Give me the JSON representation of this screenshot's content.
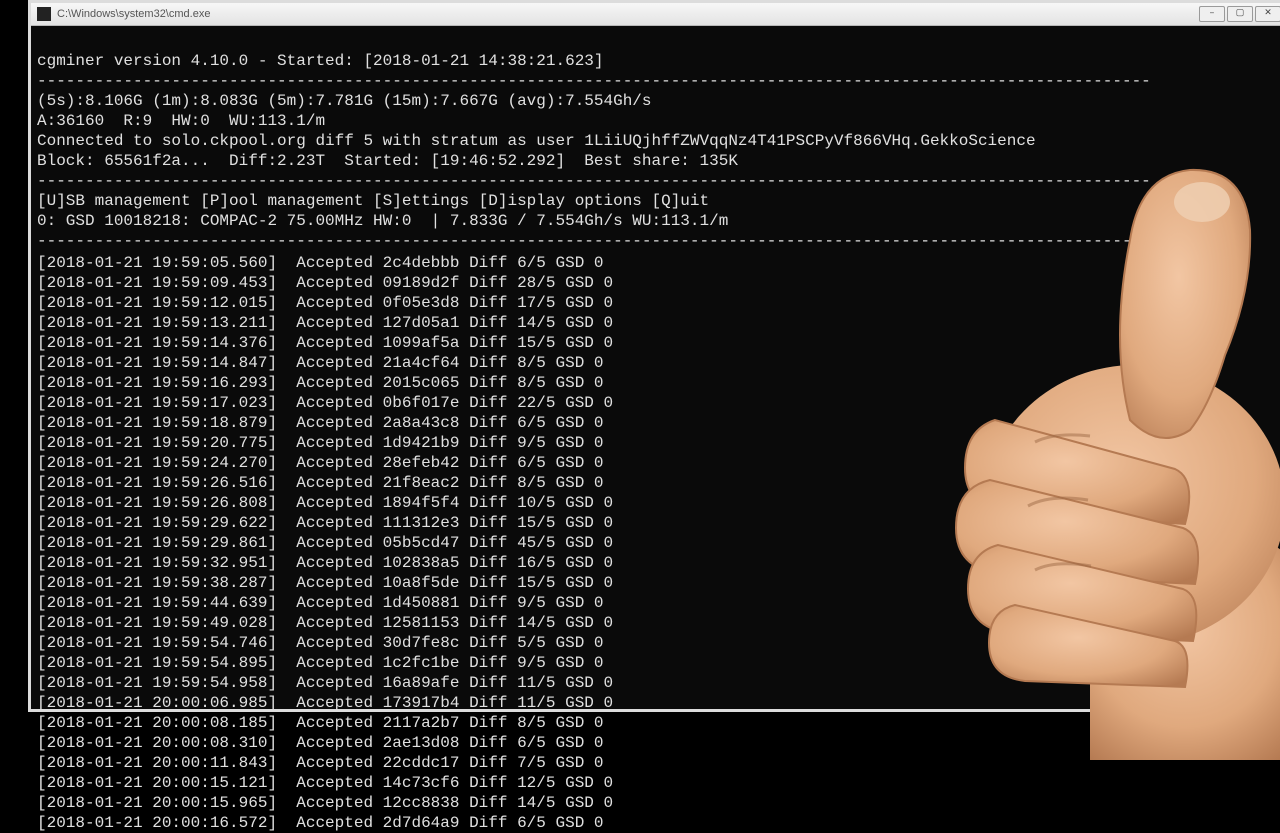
{
  "window": {
    "title": "C:\\Windows\\system32\\cmd.exe"
  },
  "header": {
    "line1": "cgminer version 4.10.0 - Started: [2018-01-21 14:38:21.623]"
  },
  "stats": {
    "hash": "(5s):8.106G (1m):8.083G (5m):7.781G (15m):7.667G (avg):7.554Gh/s",
    "accepts": "A:36160  R:9  HW:0  WU:113.1/m",
    "connected": "Connected to solo.ckpool.org diff 5 with stratum as user 1LiiUQjhffZWVqqNz4T41PSCPyVf866VHq.GekkoScience",
    "block": "Block: 65561f2a...  Diff:2.23T  Started: [19:46:52.292]  Best share: 135K"
  },
  "menu": {
    "options": "[U]SB management [P]ool management [S]ettings [D]isplay options [Q]uit",
    "device": "0: GSD 10018218: COMPAC-2 75.00MHz HW:0  | 7.833G / 7.554Gh/s WU:113.1/m"
  },
  "log": [
    "[2018-01-21 19:59:05.560]  Accepted 2c4debbb Diff 6/5 GSD 0",
    "[2018-01-21 19:59:09.453]  Accepted 09189d2f Diff 28/5 GSD 0",
    "[2018-01-21 19:59:12.015]  Accepted 0f05e3d8 Diff 17/5 GSD 0",
    "[2018-01-21 19:59:13.211]  Accepted 127d05a1 Diff 14/5 GSD 0",
    "[2018-01-21 19:59:14.376]  Accepted 1099af5a Diff 15/5 GSD 0",
    "[2018-01-21 19:59:14.847]  Accepted 21a4cf64 Diff 8/5 GSD 0",
    "[2018-01-21 19:59:16.293]  Accepted 2015c065 Diff 8/5 GSD 0",
    "[2018-01-21 19:59:17.023]  Accepted 0b6f017e Diff 22/5 GSD 0",
    "[2018-01-21 19:59:18.879]  Accepted 2a8a43c8 Diff 6/5 GSD 0",
    "[2018-01-21 19:59:20.775]  Accepted 1d9421b9 Diff 9/5 GSD 0",
    "[2018-01-21 19:59:24.270]  Accepted 28efeb42 Diff 6/5 GSD 0",
    "[2018-01-21 19:59:26.516]  Accepted 21f8eac2 Diff 8/5 GSD 0",
    "[2018-01-21 19:59:26.808]  Accepted 1894f5f4 Diff 10/5 GSD 0",
    "[2018-01-21 19:59:29.622]  Accepted 111312e3 Diff 15/5 GSD 0",
    "[2018-01-21 19:59:29.861]  Accepted 05b5cd47 Diff 45/5 GSD 0",
    "[2018-01-21 19:59:32.951]  Accepted 102838a5 Diff 16/5 GSD 0",
    "[2018-01-21 19:59:38.287]  Accepted 10a8f5de Diff 15/5 GSD 0",
    "[2018-01-21 19:59:44.639]  Accepted 1d450881 Diff 9/5 GSD 0",
    "[2018-01-21 19:59:49.028]  Accepted 12581153 Diff 14/5 GSD 0",
    "[2018-01-21 19:59:54.746]  Accepted 30d7fe8c Diff 5/5 GSD 0",
    "[2018-01-21 19:59:54.895]  Accepted 1c2fc1be Diff 9/5 GSD 0",
    "[2018-01-21 19:59:54.958]  Accepted 16a89afe Diff 11/5 GSD 0",
    "[2018-01-21 20:00:06.985]  Accepted 173917b4 Diff 11/5 GSD 0",
    "[2018-01-21 20:00:08.185]  Accepted 2117a2b7 Diff 8/5 GSD 0",
    "[2018-01-21 20:00:08.310]  Accepted 2ae13d08 Diff 6/5 GSD 0",
    "[2018-01-21 20:00:11.843]  Accepted 22cddc17 Diff 7/5 GSD 0",
    "[2018-01-21 20:00:15.121]  Accepted 14c73cf6 Diff 12/5 GSD 0",
    "[2018-01-21 20:00:15.965]  Accepted 12cc8838 Diff 14/5 GSD 0",
    "[2018-01-21 20:00:16.572]  Accepted 2d7d64a9 Diff 6/5 GSD 0"
  ],
  "divider": "--------------------------------------------------------------------------------------------------------------------"
}
